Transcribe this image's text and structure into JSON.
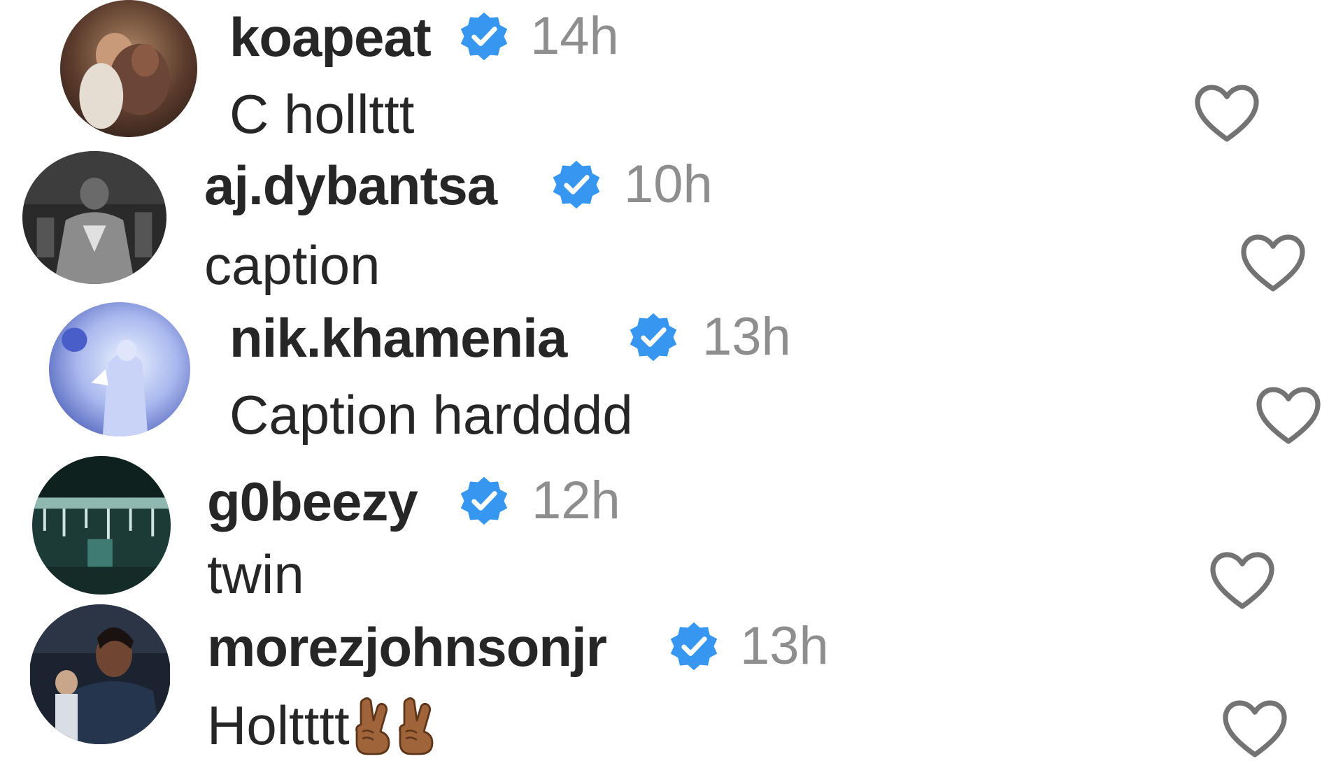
{
  "comments": [
    {
      "username": "koapeat",
      "time": "14h",
      "text": "C hollttt",
      "avatar_icon": "avatar-photo-person-hugging",
      "like_icon": "heart-outline-icon"
    },
    {
      "username": "aj.dybantsa",
      "time": "10h",
      "text": "caption",
      "avatar_icon": "avatar-photo-player-grayscale",
      "like_icon": "heart-outline-icon"
    },
    {
      "username": "nik.khamenia",
      "time": "13h",
      "text": "Caption hardddd",
      "avatar_icon": "avatar-photo-blue-stage",
      "like_icon": "heart-outline-icon"
    },
    {
      "username": "g0beezy",
      "time": "12h",
      "text": "twin",
      "avatar_icon": "avatar-photo-teal-arena",
      "like_icon": "heart-outline-icon"
    },
    {
      "username": "morezjohnsonjr",
      "time": "13h",
      "text": "Holtttt",
      "emoji": "crossed-fingers-emoji",
      "emoji_count": 2,
      "avatar_icon": "avatar-photo-player-portrait",
      "like_icon": "heart-outline-icon"
    }
  ],
  "colors": {
    "username": "#262626",
    "timestamp": "#8e8e8e",
    "verified_badge": "#3797f0",
    "heart_outline": "#737373",
    "emoji_skin": "#a0643a"
  }
}
